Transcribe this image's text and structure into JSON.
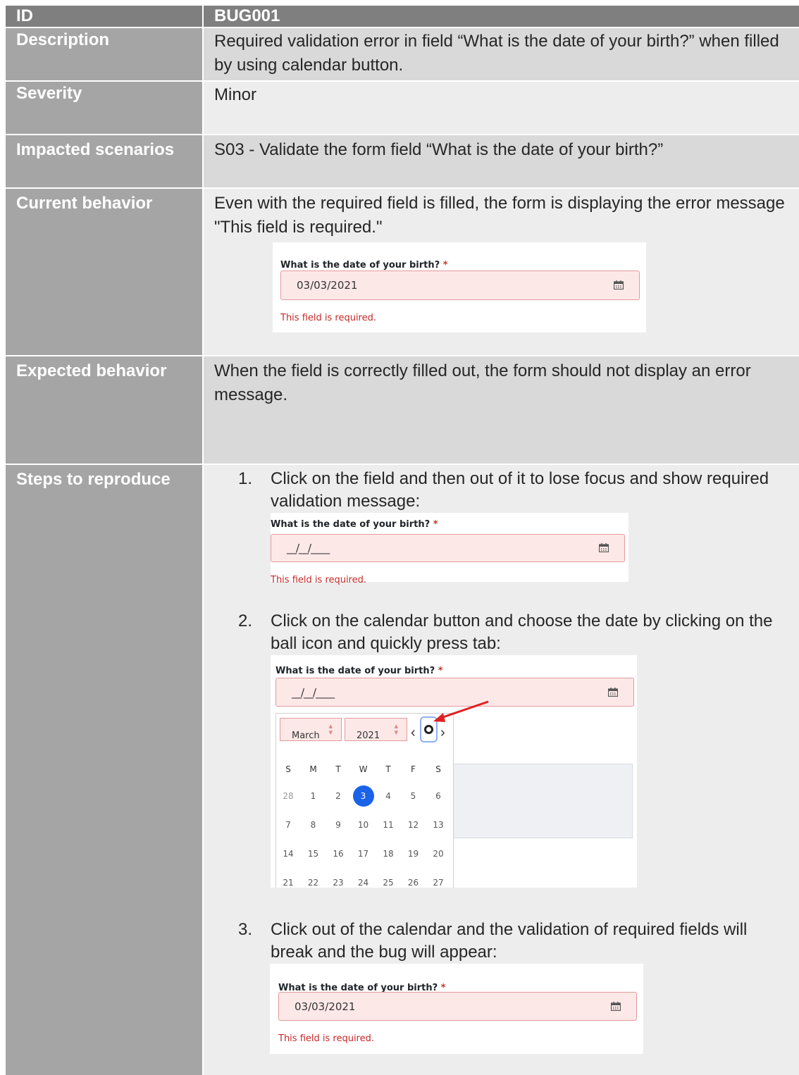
{
  "rows": {
    "id": {
      "label": "ID",
      "value": "BUG001"
    },
    "description": {
      "label": "Description",
      "value": "Required validation error in field “What is the date of your birth?” when filled by using calendar button."
    },
    "severity": {
      "label": "Severity",
      "value": "Minor"
    },
    "impacted": {
      "label": "Impacted scenarios",
      "value": "S03 - Validate the form field “What is the date of your birth?”"
    },
    "current": {
      "label": "Current behavior",
      "value": "Even with the required field is filled, the form is displaying the error message \"This field is required.\""
    },
    "expected": {
      "label": "Expected behavior",
      "value": "When the field is correctly filled out, the form should not display an error message."
    },
    "steps": {
      "label": "Steps to reproduce"
    }
  },
  "form": {
    "question": "What is the date of your birth?",
    "required_mark": "*",
    "filled_value": "03/03/2021",
    "empty_value": "__/__/____",
    "error": "This field is required."
  },
  "steps": [
    {
      "number": "1.",
      "text": "Click on the field and then out of it to lose focus and show required validation message:"
    },
    {
      "number": "2.",
      "text": "Click on the calendar button and choose the date by clicking on the ball icon and quickly press tab:"
    },
    {
      "number": "3.",
      "text": "Click out of the calendar and the validation of required fields will break and the bug will appear:"
    }
  ],
  "calendar": {
    "month": "March",
    "year": "2021",
    "weekdays": [
      "S",
      "M",
      "T",
      "W",
      "T",
      "F",
      "S"
    ],
    "weeks": [
      [
        "28",
        "1",
        "2",
        "3",
        "4",
        "5",
        "6"
      ],
      [
        "7",
        "8",
        "9",
        "10",
        "11",
        "12",
        "13"
      ],
      [
        "14",
        "15",
        "16",
        "17",
        "18",
        "19",
        "20"
      ],
      [
        "21",
        "22",
        "23",
        "24",
        "25",
        "26",
        "27"
      ]
    ],
    "selected": "3",
    "accent": "#1a62e8"
  },
  "colors": {
    "label_bg": "#a5a5a5",
    "header_bg": "#7f7f7f",
    "error": "#c62828",
    "field_bg": "#fde8e8",
    "arrow": "#e02020"
  }
}
